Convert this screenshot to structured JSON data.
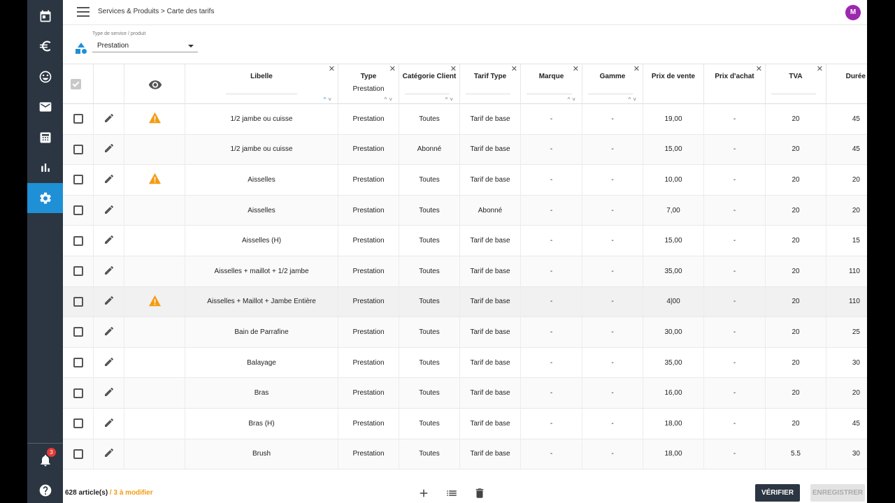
{
  "breadcrumb": "Services & Produits > Carte des tarifs",
  "user_initial": "M",
  "notifications_count": "3",
  "filter": {
    "label": "Type de service / produit",
    "value": "Prestation"
  },
  "columns": [
    {
      "key": "libelle",
      "label": "Libelle"
    },
    {
      "key": "type",
      "label": "Type",
      "filter_value": "Prestation"
    },
    {
      "key": "categorie",
      "label": "Catégorie Client"
    },
    {
      "key": "tarif_type",
      "label": "Tarif Type"
    },
    {
      "key": "marque",
      "label": "Marque"
    },
    {
      "key": "gamme",
      "label": "Gamme"
    },
    {
      "key": "prix_vente",
      "label": "Prix de vente"
    },
    {
      "key": "prix_achat",
      "label": "Prix d'achat"
    },
    {
      "key": "tva",
      "label": "TVA"
    },
    {
      "key": "duree",
      "label": "Durée"
    }
  ],
  "rows": [
    {
      "warning": true,
      "libelle": "1/2 jambe ou cuisse",
      "type": "Prestation",
      "categorie": "Toutes",
      "tarif_type": "Tarif de base",
      "marque": "-",
      "gamme": "-",
      "prix_vente": "19,00",
      "prix_achat": "-",
      "tva": "20",
      "duree": "45"
    },
    {
      "warning": false,
      "libelle": "1/2 jambe ou cuisse",
      "type": "Prestation",
      "categorie": "Abonné",
      "tarif_type": "Tarif de base",
      "marque": "-",
      "gamme": "-",
      "prix_vente": "15,00",
      "prix_achat": "-",
      "tva": "20",
      "duree": "45"
    },
    {
      "warning": true,
      "libelle": "Aisselles",
      "type": "Prestation",
      "categorie": "Toutes",
      "tarif_type": "Tarif de base",
      "marque": "-",
      "gamme": "-",
      "prix_vente": "10,00",
      "prix_achat": "-",
      "tva": "20",
      "duree": "20"
    },
    {
      "warning": false,
      "libelle": "Aisselles",
      "type": "Prestation",
      "categorie": "Toutes",
      "tarif_type": "Abonné",
      "marque": "-",
      "gamme": "-",
      "prix_vente": "7,00",
      "prix_achat": "-",
      "tva": "20",
      "duree": "20"
    },
    {
      "warning": false,
      "libelle": "Aisselles (H)",
      "type": "Prestation",
      "categorie": "Toutes",
      "tarif_type": "Tarif de base",
      "marque": "-",
      "gamme": "-",
      "prix_vente": "15,00",
      "prix_achat": "-",
      "tva": "20",
      "duree": "15"
    },
    {
      "warning": false,
      "libelle": "Aisselles + maillot + 1/2 jambe",
      "type": "Prestation",
      "categorie": "Toutes",
      "tarif_type": "Tarif de base",
      "marque": "-",
      "gamme": "-",
      "prix_vente": "35,00",
      "prix_achat": "-",
      "tva": "20",
      "duree": "110"
    },
    {
      "warning": true,
      "libelle": "Aisselles + Maillot + Jambe Entière",
      "type": "Prestation",
      "categorie": "Toutes",
      "tarif_type": "Tarif de base",
      "marque": "-",
      "gamme": "-",
      "prix_vente": "4|00",
      "prix_achat": "-",
      "tva": "20",
      "duree": "110"
    },
    {
      "warning": false,
      "libelle": "Bain de Parrafine",
      "type": "Prestation",
      "categorie": "Toutes",
      "tarif_type": "Tarif de base",
      "marque": "-",
      "gamme": "-",
      "prix_vente": "30,00",
      "prix_achat": "-",
      "tva": "20",
      "duree": "25"
    },
    {
      "warning": false,
      "libelle": "Balayage",
      "type": "Prestation",
      "categorie": "Toutes",
      "tarif_type": "Tarif de base",
      "marque": "-",
      "gamme": "-",
      "prix_vente": "35,00",
      "prix_achat": "-",
      "tva": "20",
      "duree": "30"
    },
    {
      "warning": false,
      "libelle": "Bras",
      "type": "Prestation",
      "categorie": "Toutes",
      "tarif_type": "Tarif de base",
      "marque": "-",
      "gamme": "-",
      "prix_vente": "16,00",
      "prix_achat": "-",
      "tva": "20",
      "duree": "20"
    },
    {
      "warning": false,
      "libelle": "Bras (H)",
      "type": "Prestation",
      "categorie": "Toutes",
      "tarif_type": "Tarif de base",
      "marque": "-",
      "gamme": "-",
      "prix_vente": "18,00",
      "prix_achat": "-",
      "tva": "20",
      "duree": "45"
    },
    {
      "warning": false,
      "libelle": "Brush",
      "type": "Prestation",
      "categorie": "Toutes",
      "tarif_type": "Tarif de base",
      "marque": "-",
      "gamme": "-",
      "prix_vente": "18,00",
      "prix_achat": "-",
      "tva": "5.5",
      "duree": "30"
    }
  ],
  "footer": {
    "count": "628 article(s)",
    "modified": " / 3 à modifier",
    "verify_label": "VÉRIFIER",
    "save_label": "ENREGISTRER"
  },
  "colors": {
    "sidebar": "#2b3642",
    "accent": "#1f8fd6",
    "warning": "#f39c12",
    "avatar": "#9c27b0"
  },
  "icons": [
    "calendar-icon",
    "euro-icon",
    "smiley-icon",
    "mail-icon",
    "calculator-icon",
    "bar-chart-icon",
    "gear-icon",
    "bell-icon",
    "help-icon",
    "shapes-icon",
    "eye-icon",
    "pencil-icon",
    "warning-icon",
    "plus-icon",
    "list-icon",
    "trash-icon"
  ]
}
